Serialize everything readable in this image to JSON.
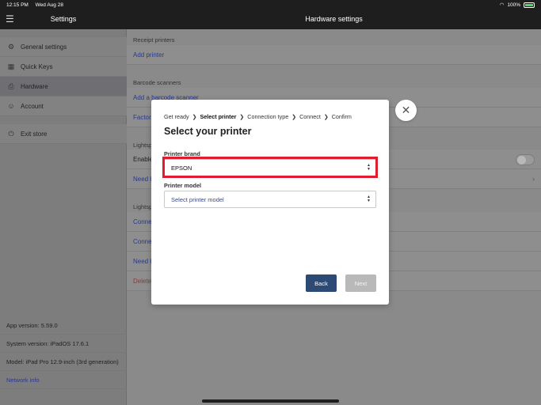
{
  "status": {
    "time": "12:15 PM",
    "date": "Wed Aug 28",
    "battery": "100%"
  },
  "sidebar": {
    "title": "Settings",
    "items": [
      {
        "label": "General settings",
        "icon": "gear-icon"
      },
      {
        "label": "Quick Keys",
        "icon": "grid-icon"
      },
      {
        "label": "Hardware",
        "icon": "printer-icon"
      },
      {
        "label": "Account",
        "icon": "person-icon"
      }
    ],
    "exit_label": "Exit store",
    "info": {
      "app_version": "App version: 5.59.0",
      "system_version": "System version: iPadOS 17.6.1",
      "model": "Model: iPad Pro 12.9-inch (3rd generation)",
      "network_info": "Network info"
    }
  },
  "main": {
    "title": "Hardware settings",
    "receipt_printers": "Receipt printers",
    "add_printer": "Add printer",
    "barcode_scanners": "Barcode scanners",
    "add_barcode_scanner": "Add a barcode scanner",
    "factory": "Factor",
    "lightspeed1": "Lightsp",
    "enable": "Enable",
    "need1": "Need h",
    "lightspeed2": "Lightsp",
    "connect1": "Conne",
    "connect2": "Conne",
    "need2": "Need h",
    "delete": "Delete"
  },
  "modal": {
    "steps": [
      "Get ready",
      "Select printer",
      "Connection type",
      "Connect",
      "Confirm"
    ],
    "current_step": "Select printer",
    "title": "Select your printer",
    "brand_label": "Printer brand",
    "brand_value": "EPSON",
    "model_label": "Printer model",
    "model_placeholder": "Select printer model",
    "back_label": "Back",
    "next_label": "Next"
  }
}
